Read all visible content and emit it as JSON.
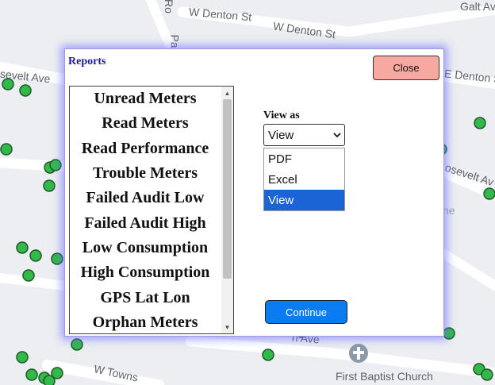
{
  "map": {
    "street_labels": [
      "W Denton St",
      "W Denton St",
      "Galt Av",
      "sevelt Ave",
      "E Denton S",
      "osevelt Av",
      "n Ave",
      "First Baptist Church",
      "W Towns",
      "Ro",
      "Pa",
      "ne"
    ],
    "church_icon": "church-cross-icon",
    "marker_color": "#33b84a"
  },
  "dialog": {
    "title": "Reports",
    "close_label": "Close",
    "reports": [
      "Unread Meters",
      "Read Meters",
      "Read Performance",
      "Trouble Meters",
      "Failed Audit Low",
      "Failed Audit High",
      "Low Consumption",
      "High Consumption",
      "GPS Lat Lon",
      "Orphan Meters"
    ],
    "view_as_label": "View as",
    "selected_view": "View",
    "view_options": [
      "PDF",
      "Excel",
      "View"
    ],
    "continue_label": "Continue"
  },
  "colors": {
    "close_button": "#f7a8a0",
    "continue_button": "#0a7cf2",
    "selected_option": "#1a64d6",
    "title": "#1a1a9c"
  }
}
